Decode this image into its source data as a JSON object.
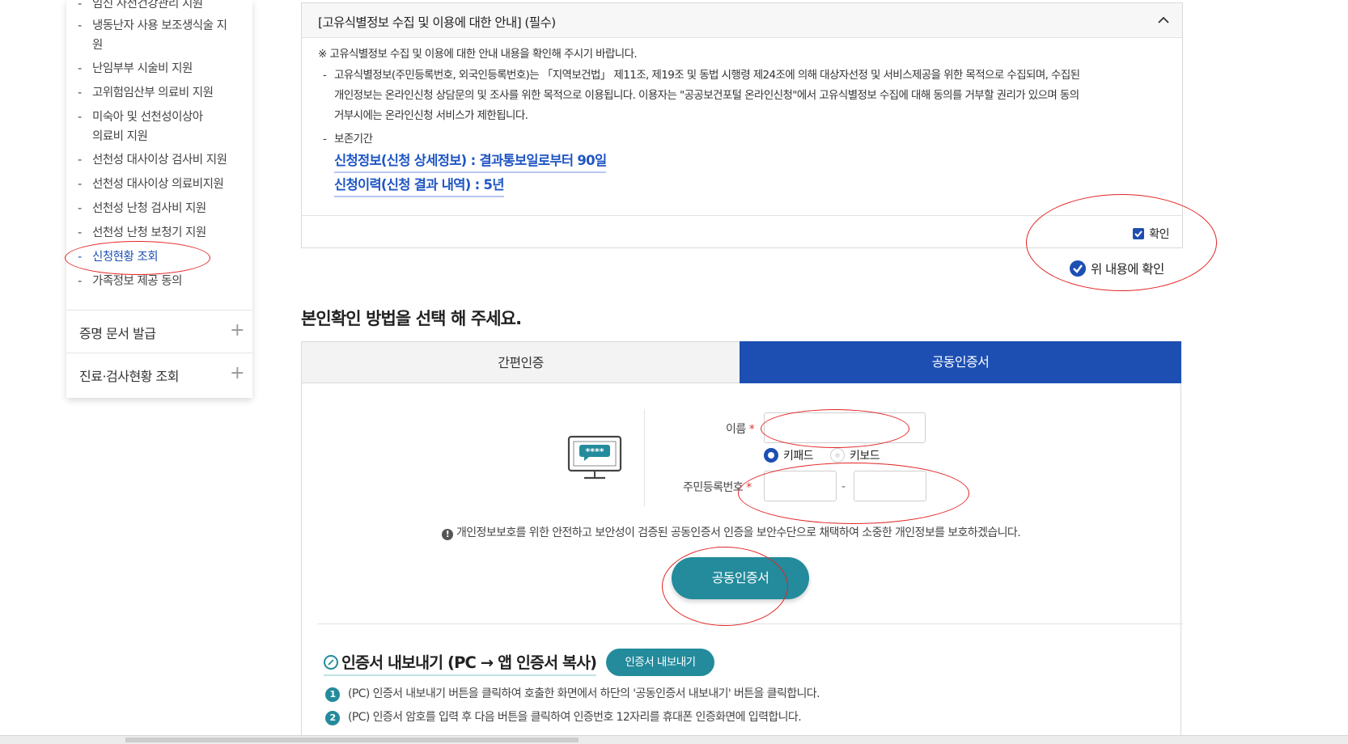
{
  "sidebar": {
    "sub_items": [
      {
        "label": "임신 사전건강관리 지원",
        "active": false
      },
      {
        "label": "냉동난자 사용 보조생식술 지원",
        "active": false
      },
      {
        "label": "난임부부 시술비 지원",
        "active": false
      },
      {
        "label": "고위험임산부 의료비 지원",
        "active": false
      },
      {
        "label": "미숙아 및 선천성이상아 의료비 지원",
        "active": false
      },
      {
        "label": "선천성 대사이상 검사비 지원",
        "active": false
      },
      {
        "label": "선천성 대사이상 의료비지원",
        "active": false
      },
      {
        "label": "선천성 난청 검사비 지원",
        "active": false
      },
      {
        "label": "선천성 난청 보청기 지원",
        "active": false
      },
      {
        "label": "신청현황 조회",
        "active": true
      },
      {
        "label": "가족정보 제공 동의",
        "active": false
      }
    ],
    "sections": [
      {
        "label": "증명 문서 발급"
      },
      {
        "label": "진료·검사현황 조회"
      }
    ]
  },
  "consent": {
    "title": "[고유식별정보 수집 및 이용에 대한 안내] (필수)",
    "intro": "※ 고유식별정보 수집 및 이용에 대한 안내 내용을 확인해 주시기 바랍니다.",
    "bullet1_line1": "고유식별정보(주민등록번호, 외국인등록번호)는 「지역보건법」 제11조, 제19조 및 동법 시행령 제24조에 의해 대상자선정 및 서비스제공을 위한 목적으로 수집되며, 수집된",
    "bullet1_line2": "개인정보는 온라인신청 상담문의 및 조사를 위한 목적으로 이용됩니다. 이용자는 \"공공보건포털 온라인신청\"에서 고유식별정보 수집에 대해 동의를 거부할 권리가 있으며 동의",
    "bullet1_line3": "거부시에는 온라인신청 서비스가 제한됩니다.",
    "bullet2": "보존기간",
    "retention1": "신청정보(신청 상세정보) : 결과통보일로부터 90일",
    "retention2": "신청이력(신청 결과 내역) : 5년",
    "confirm_label": "확인",
    "agree_label": "위 내용에 확인"
  },
  "auth": {
    "title": "본인확인 방법을 선택 해 주세요.",
    "tabs": [
      {
        "label": "간편인증",
        "active": false
      },
      {
        "label": "공동인증서",
        "active": true
      }
    ],
    "name_label": "이름",
    "required_mark": "*",
    "keyboard_options": [
      {
        "label": "키패드",
        "selected": true
      },
      {
        "label": "키보드",
        "selected": false
      }
    ],
    "rrn_label": "주민등록번호",
    "rrn_separator": "-",
    "notice": "개인정보보호를 위한 안전하고 보안성이 검증된 공동인증서 인증을 보안수단으로 채택하여 소중한 개인정보를 보호하겠습니다.",
    "cert_button": "공동인증서",
    "export_title": "인증서 내보내기 (PC → 앱 인증서 복사)",
    "export_button": "인증서 내보내기",
    "steps": [
      {
        "num": "1",
        "text": "(PC) 인증서 내보내기 버튼을 클릭하여 호출한 화면에서 하단의 '공동인증서 내보내기' 버튼을 클릭합니다."
      },
      {
        "num": "2",
        "text": "(PC) 인증서 암호를 입력 후 다음 버튼을 클릭하여 인증번호 12자리를 휴대폰 인증화면에 입력합니다."
      }
    ]
  },
  "colors": {
    "brand_blue": "#1d4fb3",
    "teal": "#238b9c",
    "annotation_red": "#e32424"
  }
}
